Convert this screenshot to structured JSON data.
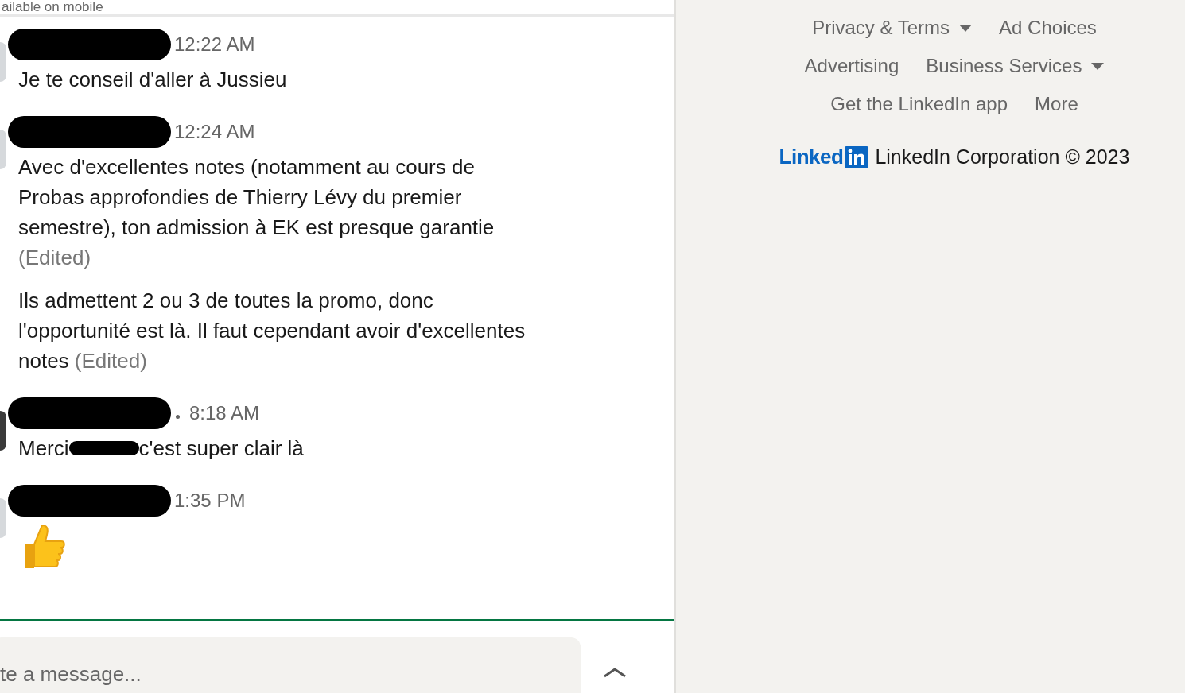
{
  "top_notice": {
    "text": "ailable on mobile"
  },
  "messages": [
    {
      "color": "#d6d9dc",
      "time": "12:22 AM",
      "dot": false,
      "bodies": [
        {
          "kind": "text",
          "parts": [
            {
              "kind": "text",
              "text": "Je te conseil d'aller à Jussieu"
            }
          ]
        }
      ]
    },
    {
      "color": "#d6d9dc",
      "time": "12:24 AM",
      "dot": false,
      "bodies": [
        {
          "kind": "text",
          "parts": [
            {
              "kind": "text",
              "text": "Avec d'excellentes notes (notamment au cours de Probas approfondies de Thierry Lévy du premier semestre), ton admission à EK est presque garantie"
            }
          ],
          "edited": "(Edited)"
        },
        {
          "kind": "text",
          "parts": [
            {
              "kind": "text",
              "text": "Ils admettent 2 ou 3 de toutes la promo, donc l'opportunité est là. Il faut cependant avoir d'excellentes notes"
            }
          ],
          "edited": "(Edited)"
        }
      ]
    },
    {
      "color": "#3a3a3a",
      "time": "8:18 AM",
      "dot": true,
      "bodies": [
        {
          "kind": "text",
          "parts": [
            {
              "kind": "text",
              "text": "Merci "
            },
            {
              "kind": "redacted"
            },
            {
              "kind": "text",
              "text": "c'est super clair là"
            }
          ]
        }
      ]
    },
    {
      "color": "#d6d9dc",
      "time": "1:35 PM",
      "dot": false,
      "bodies": [
        {
          "kind": "thumbs-up"
        }
      ]
    }
  ],
  "composer": {
    "placeholder": "te a message..."
  },
  "footer": {
    "rows": [
      [
        {
          "label": "Privacy & Terms",
          "dropdown": true
        },
        {
          "label": "Ad Choices",
          "dropdown": false
        }
      ],
      [
        {
          "label": "Advertising",
          "dropdown": false
        },
        {
          "label": "Business Services",
          "dropdown": true
        }
      ],
      [
        {
          "label": "Get the LinkedIn app",
          "dropdown": false
        },
        {
          "label": "More",
          "dropdown": false
        }
      ]
    ],
    "logo_text": "Linked",
    "copyright": "LinkedIn Corporation © 2023"
  }
}
